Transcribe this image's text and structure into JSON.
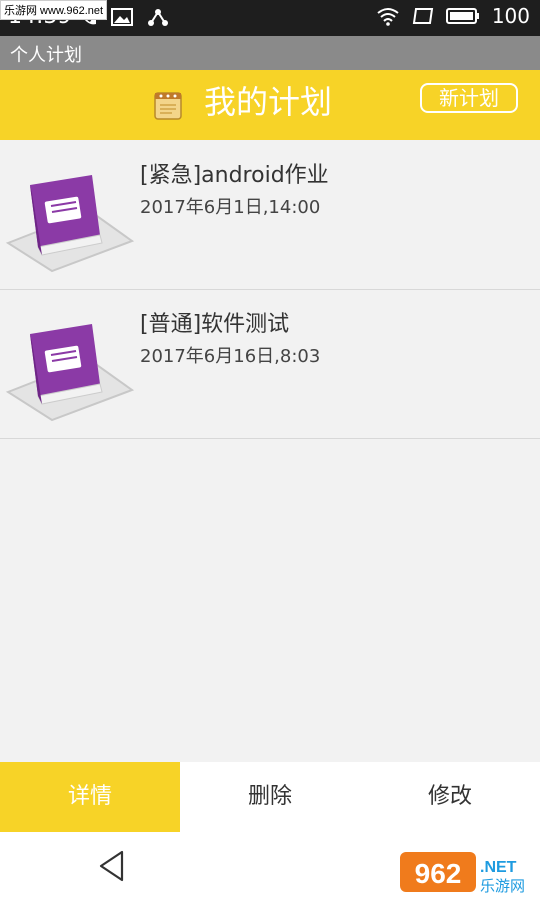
{
  "status_bar": {
    "time": "14:39",
    "battery": "100",
    "watermark": "乐游网 www.962.net"
  },
  "app_bar": {
    "title": "个人计划"
  },
  "header": {
    "title": "我的计划",
    "new_button": "新计划"
  },
  "plans": [
    {
      "title": "[紧急]android作业",
      "date": "2017年6月1日,14:00"
    },
    {
      "title": "[普通]软件测试",
      "date": "2017年6月16日,8:03"
    }
  ],
  "tabs": [
    {
      "label": "详情",
      "active": true
    },
    {
      "label": "删除",
      "active": false
    },
    {
      "label": "修改",
      "active": false
    }
  ],
  "watermark_logo": {
    "main": "962",
    "sub": ".NET",
    "cn": "乐游网"
  },
  "colors": {
    "accent": "#f7d327",
    "book": "#8b3aa6"
  }
}
